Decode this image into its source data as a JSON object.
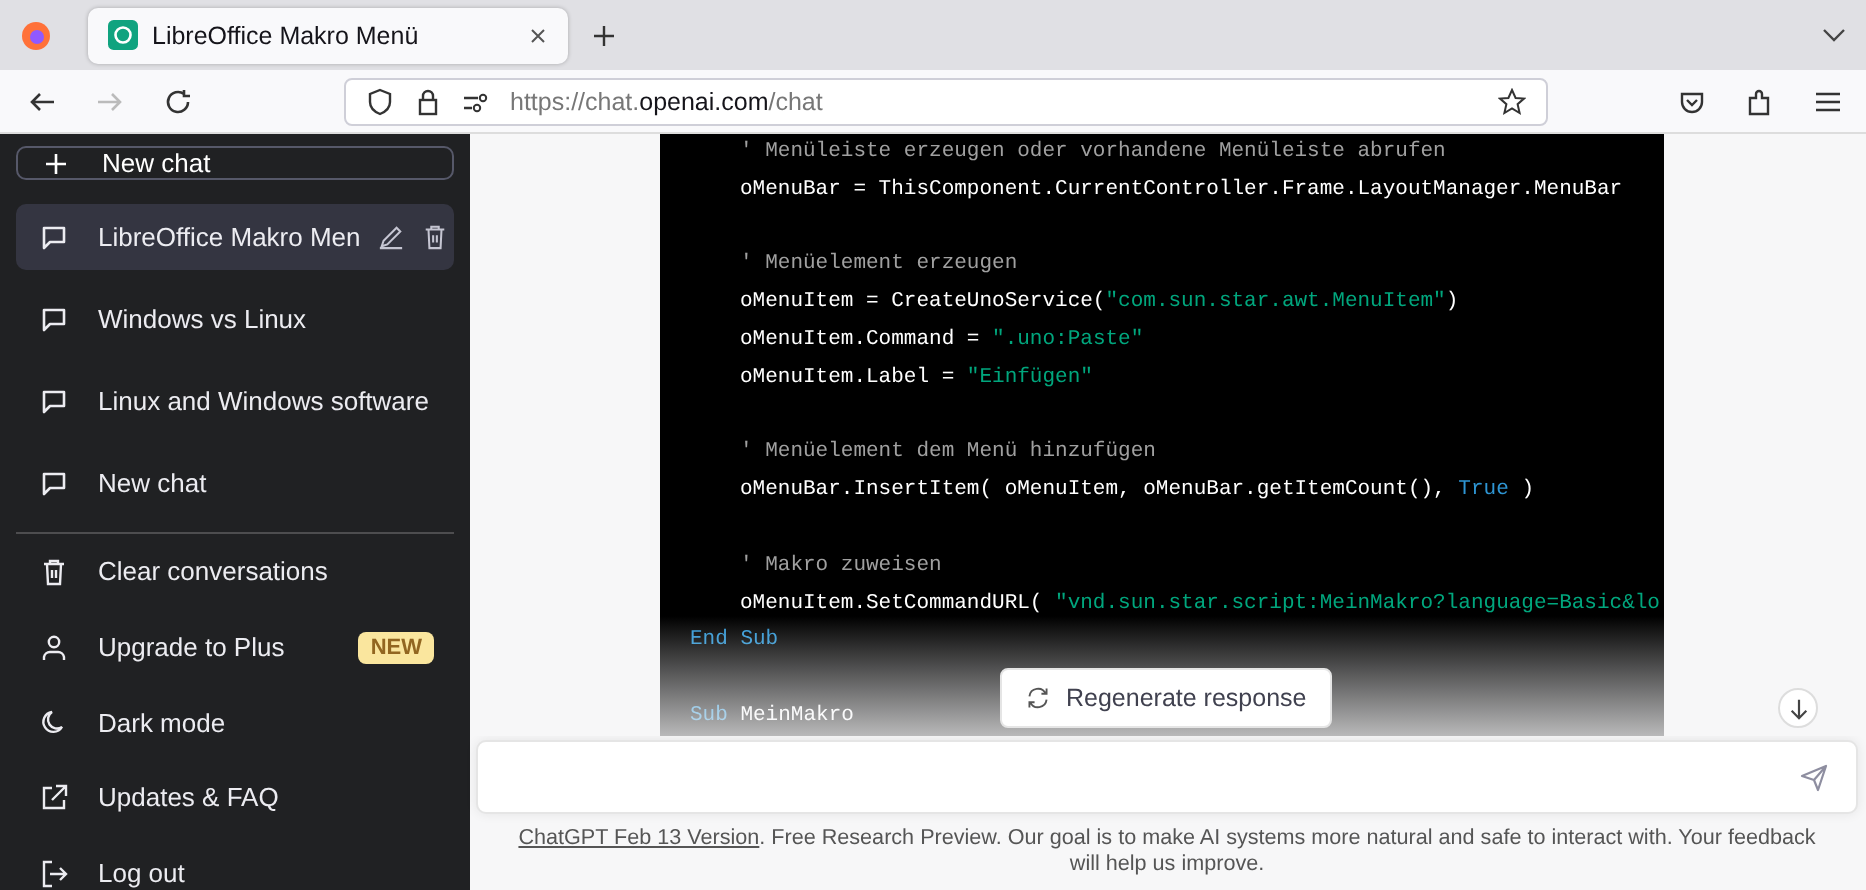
{
  "browser": {
    "tabs": [
      {
        "title": "LibreOffice Makro Menü",
        "selected": true
      }
    ],
    "back": {
      "disabled": false
    },
    "forward": {
      "disabled": true
    },
    "url": {
      "prefix": "https://chat.",
      "domain": "openai.com",
      "path": "/chat"
    }
  },
  "sidebar": {
    "new_chat": "New chat",
    "history": [
      {
        "title": "LibreOffice Makro Men",
        "selected": true
      },
      {
        "title": "Windows vs Linux",
        "selected": false
      },
      {
        "title": "Linux and Windows software",
        "selected": false
      },
      {
        "title": "New chat",
        "selected": false
      }
    ],
    "menu": [
      {
        "kind": "trash",
        "label": "Clear conversations"
      },
      {
        "kind": "user",
        "label": "Upgrade to Plus",
        "badge": "NEW"
      },
      {
        "kind": "moon",
        "label": "Dark mode"
      },
      {
        "kind": "external",
        "label": "Updates & FAQ"
      },
      {
        "kind": "logout",
        "label": "Log out"
      }
    ]
  },
  "code": {
    "lines": [
      {
        "indented": true,
        "blank_before": false,
        "tokens": [
          {
            "kind": "comment",
            "text": "' Menüleiste erzeugen oder vorhandene Menüleiste abrufen"
          }
        ]
      },
      {
        "indented": true,
        "blank_before": false,
        "tokens": [
          {
            "kind": "plain",
            "text": "oMenuBar = ThisComponent.CurrentController.Frame.LayoutManager.MenuBar"
          }
        ]
      },
      {
        "indented": true,
        "blank_before": true,
        "tokens": [
          {
            "kind": "comment",
            "text": "' Menüelement erzeugen"
          }
        ]
      },
      {
        "indented": true,
        "blank_before": false,
        "tokens": [
          {
            "kind": "plain",
            "text": "oMenuItem = CreateUnoService("
          },
          {
            "kind": "string",
            "text": "\"com.sun.star.awt.MenuItem\""
          },
          {
            "kind": "plain",
            "text": ")"
          }
        ]
      },
      {
        "indented": true,
        "blank_before": false,
        "tokens": [
          {
            "kind": "plain",
            "text": "oMenuItem.Command = "
          },
          {
            "kind": "string",
            "text": "\".uno:Paste\""
          }
        ]
      },
      {
        "indented": true,
        "blank_before": false,
        "tokens": [
          {
            "kind": "plain",
            "text": "oMenuItem.Label = "
          },
          {
            "kind": "string",
            "text": "\"Einfügen\""
          }
        ]
      },
      {
        "indented": true,
        "blank_before": true,
        "tokens": [
          {
            "kind": "comment",
            "text": "' Menüelement dem Menü hinzufügen"
          }
        ]
      },
      {
        "indented": true,
        "blank_before": false,
        "tokens": [
          {
            "kind": "plain",
            "text": "oMenuBar.InsertItem( oMenuItem, oMenuBar.getItemCount(), "
          },
          {
            "kind": "keyword",
            "text": "True"
          },
          {
            "kind": "plain",
            "text": " )"
          }
        ]
      },
      {
        "indented": true,
        "blank_before": true,
        "tokens": [
          {
            "kind": "comment",
            "text": "' Makro zuweisen"
          }
        ]
      },
      {
        "indented": true,
        "blank_before": false,
        "tokens": [
          {
            "kind": "plain",
            "text": "oMenuItem.SetCommandURL( "
          },
          {
            "kind": "string",
            "text": "\"vnd.sun.star.script:MeinMakro?language=Basic&lo"
          }
        ]
      },
      {
        "indented": false,
        "blank_before": false,
        "tokens": [
          {
            "kind": "keyword",
            "text": "End Sub"
          }
        ]
      },
      {
        "indented": false,
        "blank_before": true,
        "tokens": [
          {
            "kind": "keyword",
            "text": "Sub"
          },
          {
            "kind": "plain",
            "text": " MeinMakro"
          }
        ]
      }
    ]
  },
  "regenerate": "Regenerate response",
  "footer": {
    "link": "ChatGPT Feb 13 Version",
    "text": ". Free Research Preview. Our goal is to make AI systems more natural and safe to interact with. Your feedback will help us improve."
  }
}
